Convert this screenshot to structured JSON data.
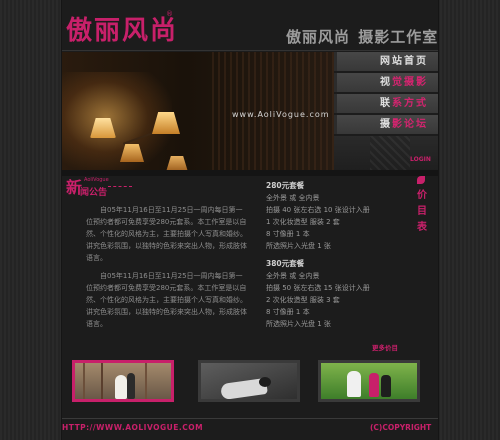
{
  "header": {
    "logo": "傲丽风尚",
    "logo_mark": "®",
    "studio_brand": "傲丽风尚",
    "studio_sep": " ",
    "studio_label": "摄影工作室"
  },
  "banner": {
    "url_text": "www.AoliVogue.com"
  },
  "nav": {
    "items": [
      {
        "label_a": "网站首页",
        "label_b": ""
      },
      {
        "label_a": "视",
        "label_b": "觉摄影"
      },
      {
        "label_a": "联",
        "label_b": "系方式"
      },
      {
        "label_a": "摄",
        "label_b": "影论坛"
      }
    ],
    "login": "LOGIN"
  },
  "news": {
    "big_char": "新",
    "small_label": "AoliVogue",
    "title": "闻公告",
    "paragraphs": [
      "自05年11月16日至11月25日一周内每日第一位预约者都可免费享受280元套系。本工作室是以自然、个性化的风格为主，主要拍摄个人写真和婚纱。讲究色彩氛围，以独特的色彩来突出人物，形成肢体语言。",
      "自05年11月16日至11月25日一周内每日第一位预约者都可免费享受280元套系。本工作室是以自然、个性化的风格为主，主要拍摄个人写真和婚纱。讲究色彩氛围，以独特的色彩来突出人物，形成肢体语言。"
    ]
  },
  "price_label": [
    "价",
    "目",
    "表"
  ],
  "packages": [
    {
      "title": "280元套餐",
      "lines": [
        "全外景 或 全内景",
        "拍摄 40 张左右选 10 张设计入册",
        "1 次化妆造型 服装 2 套",
        "8 寸像册 1 本",
        "所选照片入光盘 1 张"
      ]
    },
    {
      "title": "380元套餐",
      "lines": [
        "全外景 或 全内景",
        "拍摄 50 张左右选 15 张设计入册",
        "2 次化妆造型 服装 3 套",
        "8 寸像册 1 本",
        "所选照片入光盘 1 张"
      ]
    }
  ],
  "more_label": "更多价目",
  "footer": {
    "url": "HTTP://WWW.AOLIVOGUE.COM",
    "copyright": "(C)COPYRIGHT"
  },
  "colors": {
    "accent": "#c8206a",
    "background": "#262626",
    "panel": "#1c1c1c"
  }
}
